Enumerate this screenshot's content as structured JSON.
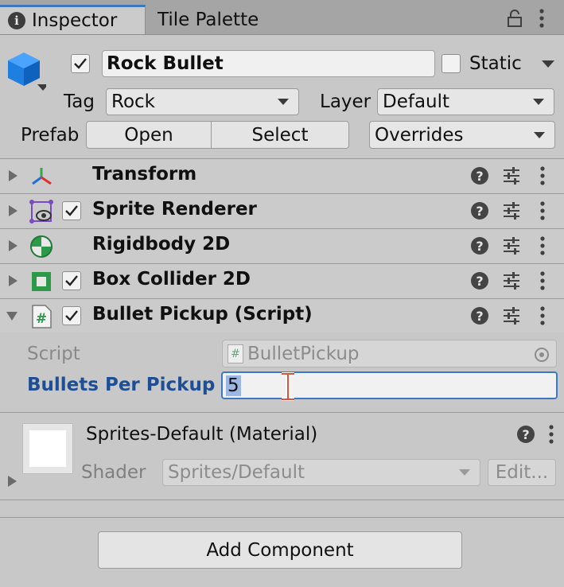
{
  "tabs": {
    "inspector": "Inspector",
    "tile_palette": "Tile Palette"
  },
  "header": {
    "object_name": "Rock Bullet",
    "active_checked": true,
    "static_label": "Static",
    "static_checked": false,
    "tag_label": "Tag",
    "tag_value": "Rock",
    "layer_label": "Layer",
    "layer_value": "Default",
    "prefab_label": "Prefab",
    "open_label": "Open",
    "select_label": "Select",
    "overrides_label": "Overrides"
  },
  "components": [
    {
      "name": "Transform",
      "icon": "transform-icon",
      "checkbox": false,
      "expanded": false
    },
    {
      "name": "Sprite Renderer",
      "icon": "sprite-renderer-icon",
      "checkbox": true,
      "expanded": false
    },
    {
      "name": "Rigidbody 2D",
      "icon": "rigidbody2d-icon",
      "checkbox": false,
      "expanded": false
    },
    {
      "name": "Box Collider 2D",
      "icon": "box-collider-icon",
      "checkbox": true,
      "expanded": false
    },
    {
      "name": "Bullet Pickup (Script)",
      "icon": "script-icon",
      "checkbox": true,
      "expanded": true
    }
  ],
  "script_fields": {
    "script_label": "Script",
    "script_value": "BulletPickup",
    "bullets_label": "Bullets Per Pickup",
    "bullets_value": "5"
  },
  "material": {
    "title": "Sprites-Default (Material)",
    "shader_label": "Shader",
    "shader_value": "Sprites/Default",
    "edit_label": "Edit..."
  },
  "add_component_label": "Add Component",
  "colors": {
    "accent_blue": "#3a79c9",
    "label_blue": "#1e4f94",
    "panel_bg": "#c8c8c8"
  }
}
